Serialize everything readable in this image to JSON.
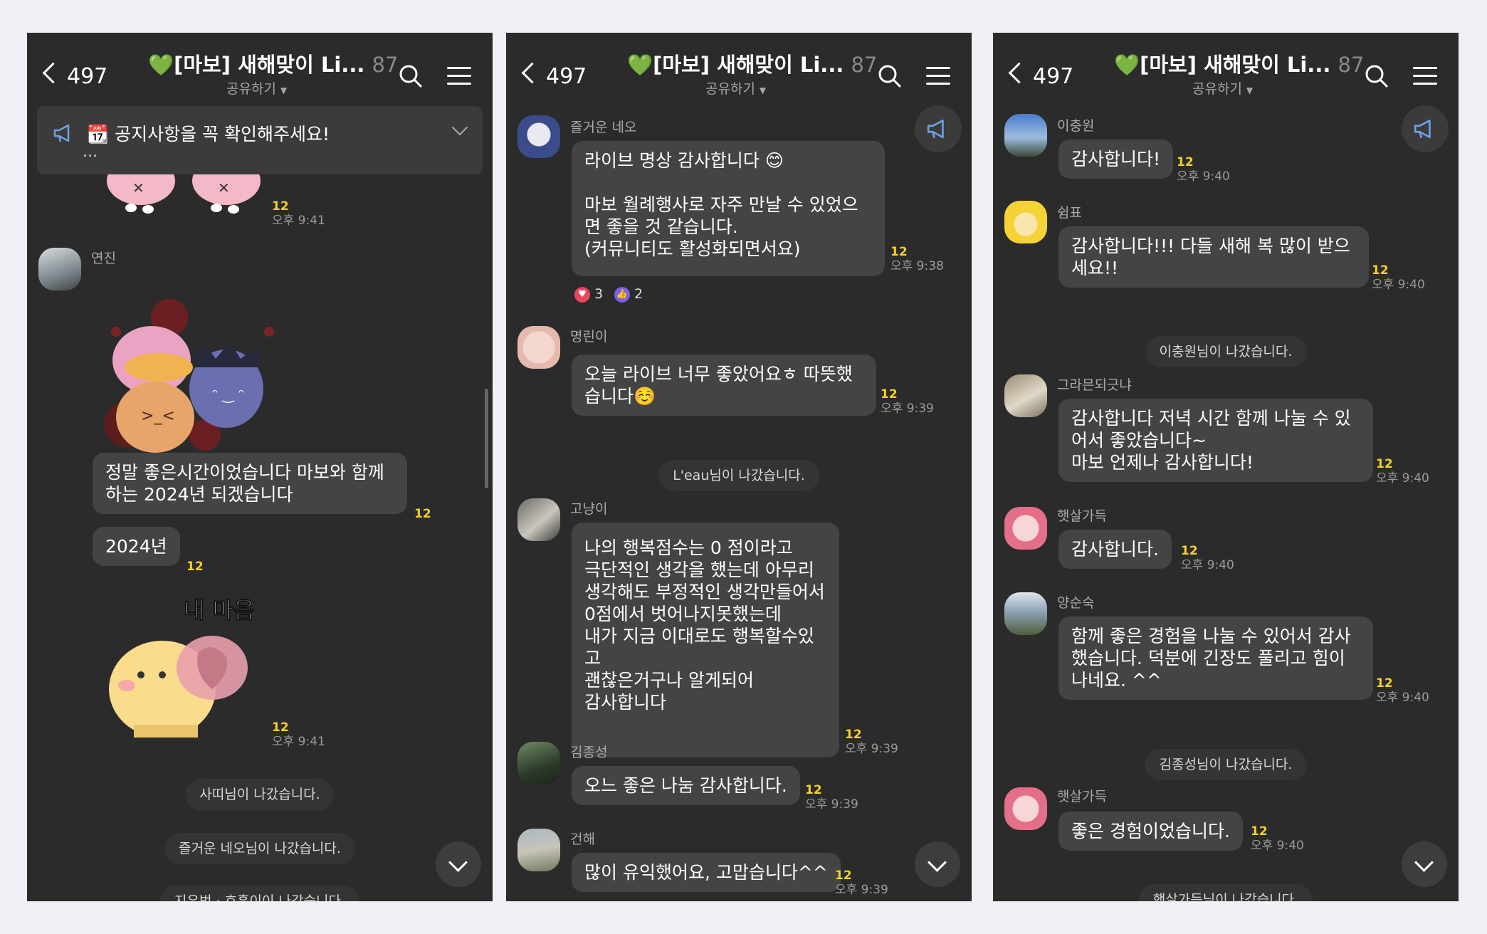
{
  "header": {
    "back_count": "497",
    "heart": "💚",
    "title": "[마보] 새해맞이 Li...",
    "member_count": "87",
    "share": "공유하기"
  },
  "panel1": {
    "notice_text": "📆 공지사항을 꼭 확인해주세요!",
    "notice_more": "...",
    "sticker1_meta": {
      "count": "12",
      "time": "오후 9:41"
    },
    "yeonjin": {
      "name": "연진",
      "msg1": "정말 좋은시간이었습니다 마보와 함께하는 2024년 되겠습니다",
      "msg1_count": "12",
      "msg2": "2024년",
      "msg2_count": "12",
      "sticker_text": "내 마음",
      "sticker_count": "12",
      "sticker_time": "오후 9:41"
    },
    "system1": "사띠님이 나갔습니다.",
    "system2": "즐거운 네오님이 나갔습니다.",
    "system3": "지우범 · 호흡이이 나갔습니다."
  },
  "panel2": {
    "m1": {
      "name": "즐거운 네오",
      "text": "라이브 명상 감사합니다 😊\n\n마보 월례행사로 자주 만날 수 있었으면 좋을 것 같습니다.\n(커뮤니티도 활성화되면서요)",
      "count": "12",
      "time": "오후 9:38",
      "heart_reacts": "3",
      "like_reacts": "2"
    },
    "m2": {
      "name": "명린이",
      "text": "오늘 라이브 너무 좋았어요ㅎ 따뜻했습니다☺️",
      "count": "12",
      "time": "오후 9:39"
    },
    "system1": "L'eau님이 나갔습니다.",
    "m3": {
      "name": "고냥이",
      "text": "나의 행복점수는 0 점이라고\n극단적인 생각을 했는데 아무리\n생각해도 부정적인 생각만들어서\n0점에서 벗어나지못했는데\n내가 지금 이대로도 행복할수있고\n괜찮은거구나 알게되어\n감사합니다",
      "count": "12",
      "time": "오후 9:39"
    },
    "m4": {
      "name": "김종성",
      "text": "오느 좋은 나눔 감사합니다.",
      "count": "12",
      "time": "오후 9:39"
    },
    "m5": {
      "name": "건해",
      "text": "많이 유익했어요, 고맙습니다^^",
      "count": "12",
      "time": "오후 9:39"
    }
  },
  "panel3": {
    "m1": {
      "name": "이충원",
      "text": "감사합니다!",
      "count": "12",
      "time": "오후 9:40"
    },
    "m2": {
      "name": "쉼표",
      "text": "감사합니다!!! 다들 새해 복 많이 받으세요!!",
      "count": "12",
      "time": "오후 9:40"
    },
    "system1": "이충원님이 나갔습니다.",
    "m3": {
      "name": "그라믄되긋냐",
      "text": "감사합니다 저녁 시간 함께 나눌 수 있어서 좋았습니다~\n마보 언제나 감사합니다!",
      "count": "12",
      "time": "오후 9:40"
    },
    "m4": {
      "name": "햇살가득",
      "text": "감사합니다.",
      "count": "12",
      "time": "오후 9:40"
    },
    "m5": {
      "name": "양순숙",
      "text": "함께 좋은 경험을 나눌  수 있어서 감사했습니다. 덕분에 긴장도 풀리고 힘이 나네요. ^^",
      "count": "12",
      "time": "오후 9:40"
    },
    "system2": "김종성님이 나갔습니다.",
    "m6": {
      "name": "햇살가득",
      "text": "좋은 경험이었습니다.",
      "count": "12",
      "time": "오후 9:40"
    },
    "system3": "햇살가득님이 나갔습니다."
  },
  "colors": {
    "background": "#2b2b2b",
    "bubble": "#444444",
    "read_count": "#f5d02a",
    "page_bg": "#f1f0f7",
    "heart": "#2fd35b"
  },
  "icons": [
    "back-arrow-icon",
    "search-icon",
    "menu-icon",
    "megaphone-icon",
    "chevron-down-icon",
    "heart-icon",
    "thumbs-up-icon"
  ]
}
